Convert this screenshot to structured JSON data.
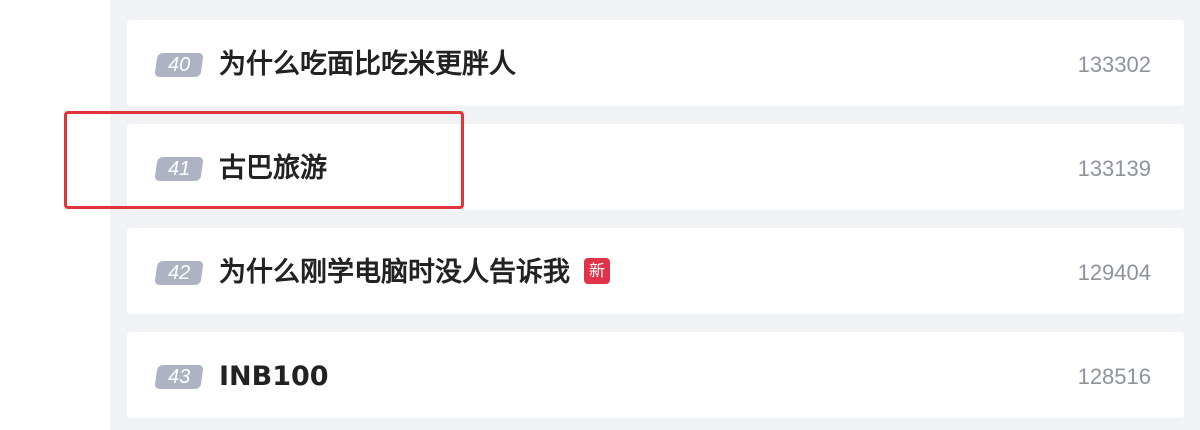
{
  "colors": {
    "panel_background": "#f1f2f6",
    "row_background": "#ffffff",
    "rank_badge": "#adb3c2",
    "new_badge": "#e0334a",
    "highlight_box": "#e0343a",
    "title_text": "#222222",
    "count_text": "#8f939c"
  },
  "trending_list": {
    "items": [
      {
        "rank": "40",
        "title": "为什么吃面比吃米更胖人",
        "count": "133302"
      },
      {
        "rank": "41",
        "title": "古巴旅游",
        "count": "133139"
      },
      {
        "rank": "42",
        "title": "为什么刚学电脑时没人告诉我",
        "badge": "新",
        "count": "129404"
      },
      {
        "rank": "43",
        "title": "INB100",
        "count": "128516"
      }
    ]
  }
}
